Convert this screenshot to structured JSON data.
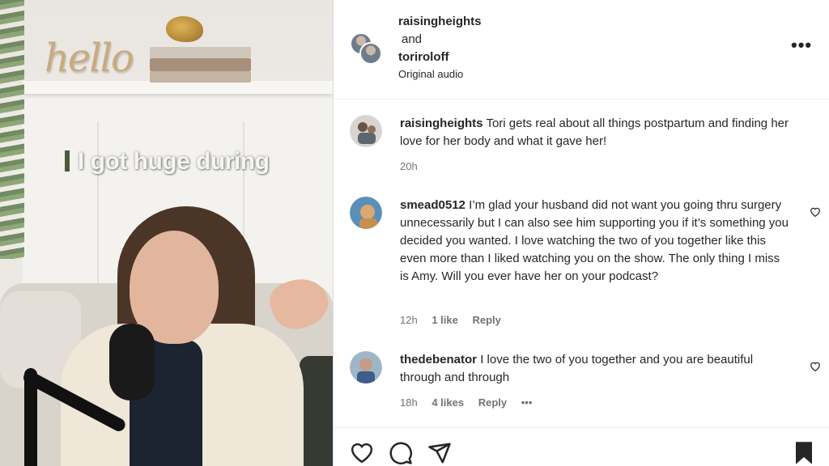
{
  "video": {
    "caption": "I got huge during"
  },
  "header": {
    "user1": "raisingheights",
    "and": "and",
    "user2": "toriroloff",
    "audio": "Original audio",
    "more_icon": "more-horizontal-icon"
  },
  "comments": [
    {
      "user": "raisingheights",
      "text": "Tori gets real about all things postpartum and finding her love for her body and what it gave her!",
      "time": "20h"
    },
    {
      "user": "smead0512",
      "text": "I’m glad your husband did not want you going thru surgery unnecessarily but I can also see him supporting you if it’s something you decided you wanted. I love watching the two of you together like this even more than I liked watching you on the show. The only thing I miss is Amy. Will you ever have her on your podcast?",
      "time": "12h",
      "likes": "1 like",
      "reply": "Reply"
    },
    {
      "user": "thedebenator",
      "text": "I love the two of you together and you are beautiful through and through",
      "time": "18h",
      "likes": "4 likes",
      "reply": "Reply",
      "more": "•••"
    }
  ],
  "actions": [
    "heart-icon",
    "comment-icon",
    "share-icon",
    "bookmark-icon"
  ],
  "colors": {
    "text": "#262626",
    "muted": "#737373",
    "divider": "#efefef"
  }
}
